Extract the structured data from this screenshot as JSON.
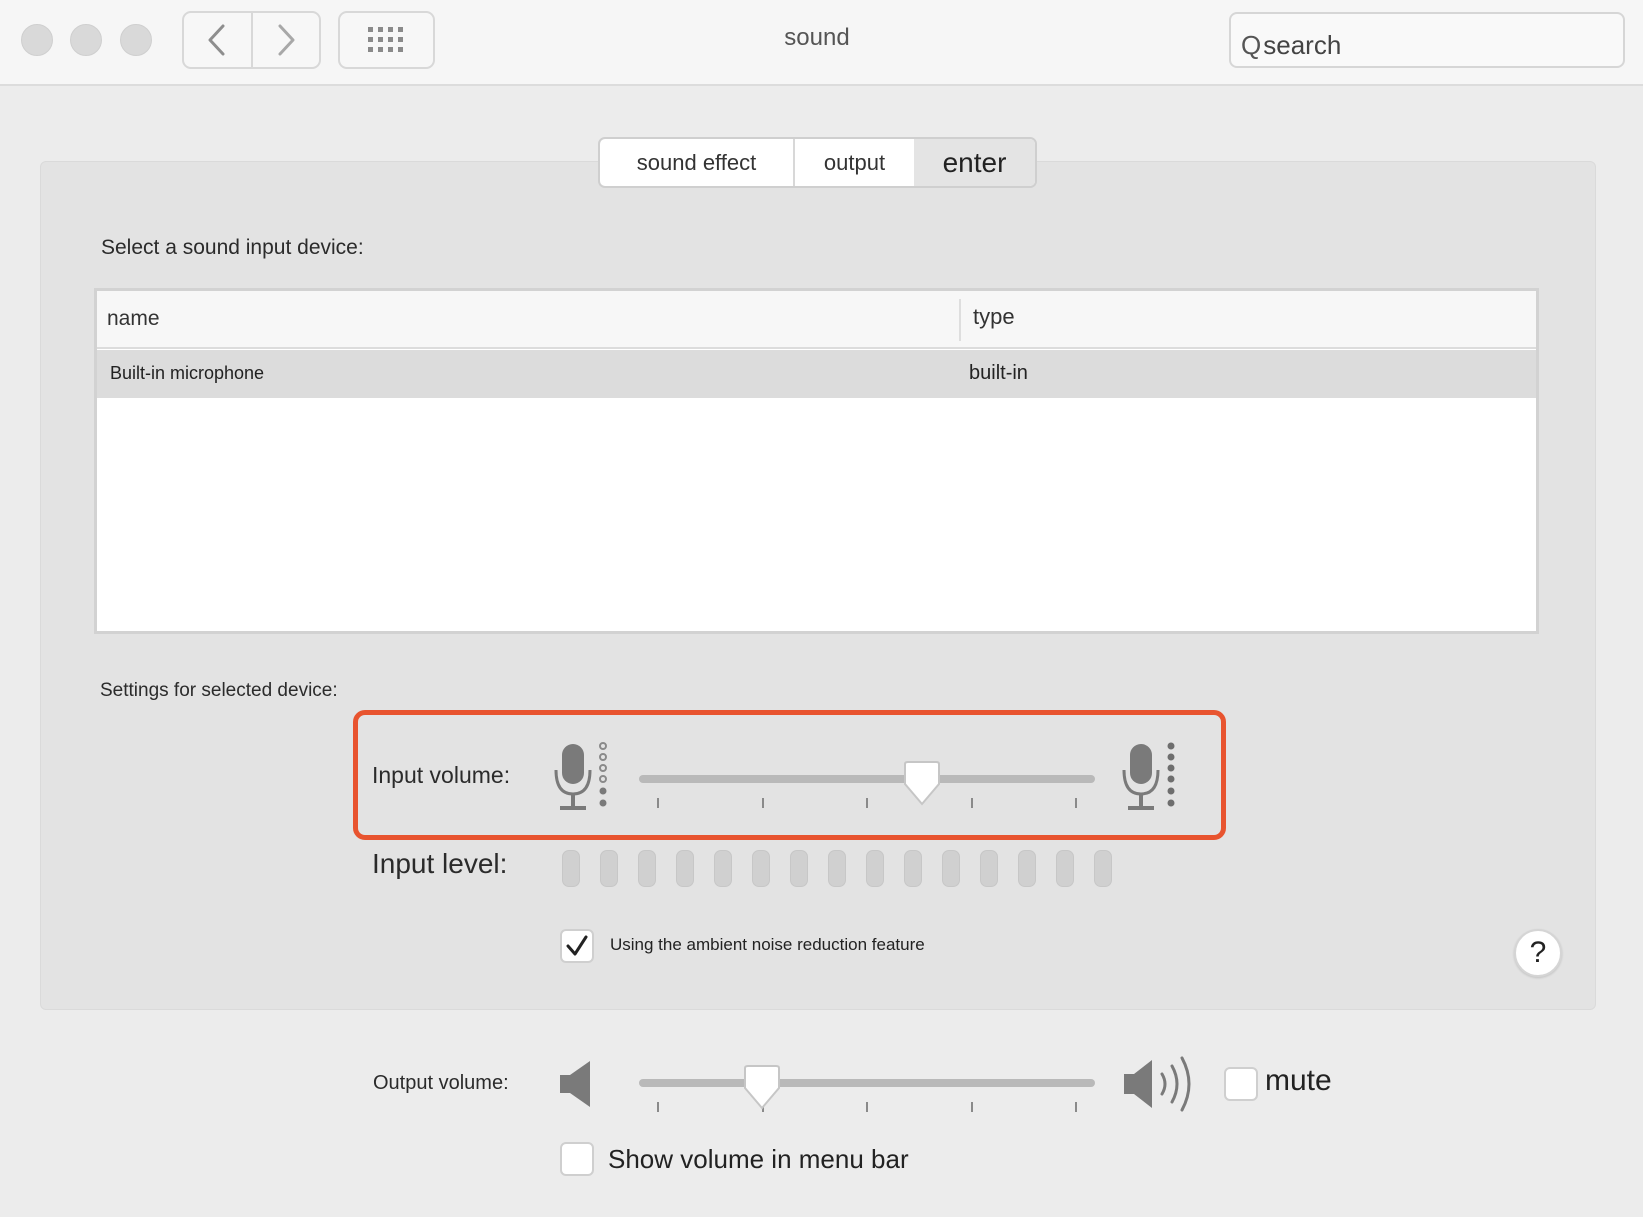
{
  "window": {
    "title": "sound",
    "search_icon_glyph": "Q",
    "search_placeholder": "search"
  },
  "tabs": [
    {
      "label": "sound effect",
      "active": false
    },
    {
      "label": "output",
      "active": false
    },
    {
      "label": "enter",
      "active": true
    }
  ],
  "input_section": {
    "select_label": "Select a sound input device:",
    "table": {
      "columns": [
        "name",
        "type"
      ],
      "rows": [
        {
          "name": "Built-in microphone",
          "type": "built-in",
          "selected": true
        }
      ]
    },
    "settings_label": "Settings for selected device:",
    "input_volume_label": "Input volume:",
    "input_volume_value": 0.62,
    "input_level_label": "Input level:",
    "input_level_bar_count": 15,
    "input_level_active": 0,
    "noise_reduction": {
      "label": "Using the ambient noise reduction feature",
      "checked": true
    },
    "help_label": "?"
  },
  "output_section": {
    "output_volume_label": "Output volume:",
    "output_volume_value": 0.27,
    "mute": {
      "label": "mute",
      "checked": false
    },
    "show_in_menu_bar": {
      "label": "Show volume in menu bar",
      "checked": false
    }
  },
  "colors": {
    "highlight": "#e8542f",
    "panel": "#e3e3e3",
    "titlebar": "#f6f6f6",
    "level_bar_inactive": "#d0d0d0"
  },
  "icons": {
    "window_controls": [
      "close-icon",
      "minimize-icon",
      "maximize-icon"
    ],
    "nav": [
      "chevron-left-icon",
      "chevron-right-icon",
      "grid-icon"
    ],
    "input_low": "microphone-low-icon",
    "input_high": "microphone-high-icon",
    "output_low": "speaker-low-icon",
    "output_high": "speaker-high-icon",
    "checkmark": "checkmark-icon"
  }
}
